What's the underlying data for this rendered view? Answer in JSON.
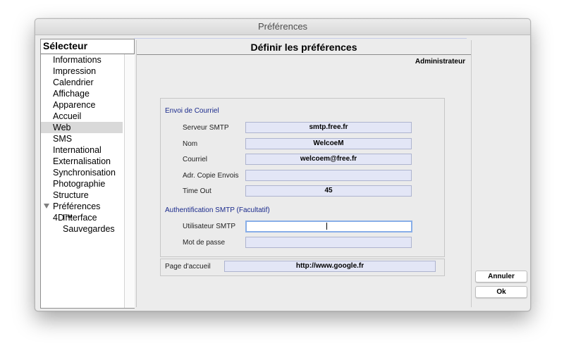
{
  "window": {
    "title": "Préférences"
  },
  "selector": {
    "header": "Sélecteur",
    "items": [
      {
        "label": "Informations"
      },
      {
        "label": "Impression"
      },
      {
        "label": "Calendrier"
      },
      {
        "label": "Affichage"
      },
      {
        "label": "Apparence"
      },
      {
        "label": "Accueil"
      },
      {
        "label": "Web",
        "selected": true
      },
      {
        "label": "SMS"
      },
      {
        "label": "International"
      },
      {
        "label": "Externalisation"
      },
      {
        "label": "Synchronisation"
      },
      {
        "label": "Photographie"
      },
      {
        "label": "Structure"
      },
      {
        "label": "Préférences 4D™",
        "expanded": true
      },
      {
        "label": "Interface",
        "child": true
      },
      {
        "label": "Sauvegardes",
        "child": true
      }
    ]
  },
  "main": {
    "title": "Définir les préférences",
    "user": "Administrateur",
    "mail": {
      "section": "Envoi de Courriel",
      "smtp_server": {
        "label": "Serveur SMTP",
        "value": "smtp.free.fr"
      },
      "name": {
        "label": "Nom",
        "value": "WelcoeM"
      },
      "email": {
        "label": "Courriel",
        "value": "welcoem@free.fr"
      },
      "cc": {
        "label": "Adr. Copie Envois",
        "value": ""
      },
      "timeout": {
        "label": "Time Out",
        "value": "45"
      }
    },
    "auth": {
      "section": "Authentification SMTP (Facultatif)",
      "smtp_user": {
        "label": "Utilisateur  SMTP",
        "value": ""
      },
      "password": {
        "label": "Mot de passe",
        "value": ""
      }
    },
    "homepage": {
      "label": "Page d'accueil",
      "value": "http://www.google.fr"
    }
  },
  "buttons": {
    "cancel": "Annuler",
    "ok": "Ok"
  },
  "colors": {
    "selection": "#d9d9d9",
    "field": "#e3e6f6",
    "section_text": "#1a2a8c",
    "focus_ring": "#88aee8"
  }
}
